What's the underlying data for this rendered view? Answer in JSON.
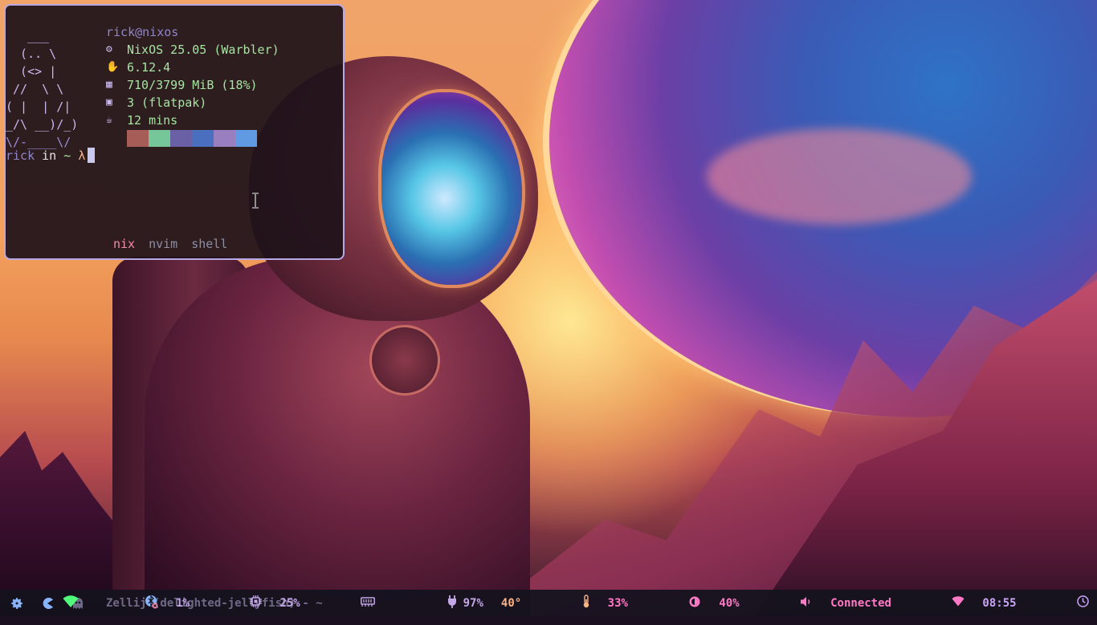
{
  "terminal": {
    "userhost": "rick@nixos",
    "ascii": [
      "   ___",
      "  (.. \\",
      "  (<> |",
      " //  \\ \\",
      "( |  | /|",
      "_/\\ __)/_)",
      "\\/-____\\/"
    ],
    "info": [
      {
        "icon": "os-gear-icon",
        "glyph": "⚙",
        "value": "NixOS 25.05 (Warbler)"
      },
      {
        "icon": "kernel-hand-icon",
        "glyph": "✋",
        "value": "6.12.4"
      },
      {
        "icon": "memory-chip-icon",
        "glyph": "▦",
        "value": "710/3799 MiB (18%)"
      },
      {
        "icon": "package-box-icon",
        "glyph": "▣",
        "value": "3 (flatpak)"
      },
      {
        "icon": "uptime-cup-icon",
        "glyph": "☕",
        "value": "12 mins"
      }
    ],
    "palette_icon": "palette-icon",
    "colors": [
      "#a65c57",
      "#75c79a",
      "#6a60a6",
      "#4a6fbf",
      "#9a7fc0",
      "#5f9ae3"
    ],
    "prompt": {
      "user": "rick",
      "in": "in",
      "dir": "~",
      "symbol": "λ"
    },
    "tabs": [
      "nix",
      "nvim",
      "shell"
    ],
    "active_tab": 0
  },
  "taskbar": {
    "left_icons": [
      "settings-gear-icon",
      "pacman-icon",
      "ghost-icon"
    ],
    "window_title": "Zellij (delighted-jellyfish) - ~",
    "modules": [
      {
        "name": "cpu",
        "value": "1%",
        "icon": "cpu-icon"
      },
      {
        "name": "memory",
        "value": "25%",
        "icon": "memory-icon"
      },
      {
        "name": "battery",
        "value": "97%",
        "icon": "battery-plug-icon"
      },
      {
        "name": "temperature",
        "value": "40°",
        "icon": "thermometer-icon"
      },
      {
        "name": "brightness",
        "value": "33%",
        "icon": "brightness-icon"
      },
      {
        "name": "volume",
        "value": "40%",
        "icon": "volume-icon"
      },
      {
        "name": "network",
        "value": "Connected",
        "icon": "wifi-icon"
      },
      {
        "name": "clock",
        "value": "08:55",
        "icon": "clock-icon"
      }
    ],
    "colors": {
      "accent": "#c4a7e7",
      "wifi": "#50fa7b",
      "bluetooth": "#89b4fa",
      "network": "#ff79c6"
    }
  }
}
